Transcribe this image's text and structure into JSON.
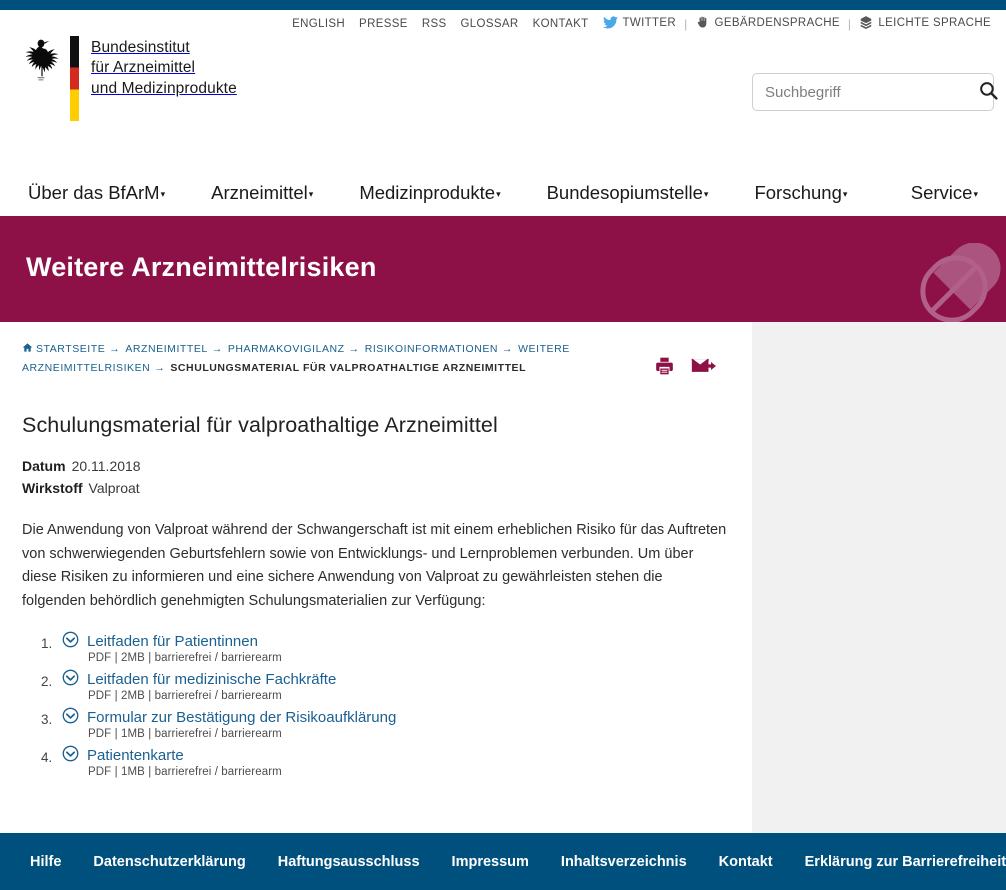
{
  "meta_nav": {
    "items": [
      {
        "label": "ENGLISH",
        "icon": null
      },
      {
        "label": "PRESSE",
        "icon": null
      },
      {
        "label": "RSS",
        "icon": null
      },
      {
        "label": "GLOSSAR",
        "icon": null
      },
      {
        "label": "KONTAKT",
        "icon": null
      },
      {
        "label": "TWITTER",
        "icon": "twitter-bird-icon"
      },
      {
        "label": "GEBÄRDENSPRACHE",
        "icon": "sign-language-hand-icon"
      },
      {
        "label": "LEICHTE SPRACHE",
        "icon": "easy-language-icon"
      }
    ],
    "separator": "|"
  },
  "logo": {
    "eagle_alt": "bundesadler-icon",
    "line1": "Bundesinstitut",
    "line2": "für Arzneimittel",
    "line3": "und Medizinprodukte"
  },
  "search": {
    "placeholder": "Suchbegriff",
    "value": "",
    "button_label": "search-icon"
  },
  "main_nav": {
    "items": [
      {
        "label": "Über das BfArM",
        "has_submenu": true
      },
      {
        "label": "Arzneimittel",
        "has_submenu": true
      },
      {
        "label": "Medizinprodukte",
        "has_submenu": true
      },
      {
        "label": "Bundesopiumstelle",
        "has_submenu": true
      },
      {
        "label": "Forschung",
        "has_submenu": true
      },
      {
        "label": "Service",
        "has_submenu": true
      }
    ],
    "caret": "▾"
  },
  "banner": {
    "title": "Weitere Arzneimittelrisiken",
    "bg_color": "#8d1146",
    "decor_icon": "pill-capsule-icon"
  },
  "breadcrumb": {
    "home_icon": "home-icon",
    "arrow": "→",
    "items": [
      {
        "label": "STARTSEITE",
        "current": false
      },
      {
        "label": "ARZNEIMITTEL",
        "current": false
      },
      {
        "label": "PHARMAKOVIGILANZ",
        "current": false
      },
      {
        "label": "RISIKOINFORMATIONEN",
        "current": false
      },
      {
        "label": "WEITERE ARZNEIMITTELRISIKEN",
        "current": false
      },
      {
        "label": "SCHULUNGSMATERIAL FÜR VALPROATHALTIGE ARZNEIMITTEL",
        "current": true
      }
    ]
  },
  "page_tools": [
    {
      "name": "print-icon",
      "title": "Drucken"
    },
    {
      "name": "email-icon",
      "title": "Empfehlen"
    }
  ],
  "article": {
    "title": "Schulungsmaterial für valproathaltige Arzneimittel",
    "meta": [
      {
        "key": "Datum",
        "value": "20.11.2018"
      },
      {
        "key": "Wirkstoff",
        "value": "Valproat"
      }
    ],
    "paragraph": "Die Anwendung von Valproat während der Schwangerschaft ist mit einem erheblichen Risiko für das Auftreten von schwerwiegenden Geburtsfehlern sowie von Entwicklungs- und Lernproblemen verbunden. Um über diese Risiken zu informieren und eine sichere Anwendung von Valproat zu gewährleisten stehen die folgenden behördlich genehmigten Schulungsmaterialien zur Verfügung:",
    "downloads": [
      {
        "number": "1.",
        "icon": "download-chevron-icon",
        "label": "Leitfaden für Patientinnen",
        "meta": "PDF | 2MB | barrierefrei / barrierearm"
      },
      {
        "number": "2.",
        "icon": "download-chevron-icon",
        "label": "Leitfaden für medizinische Fachkräfte",
        "meta": "PDF | 2MB | barrierefrei / barrierearm"
      },
      {
        "number": "3.",
        "icon": "download-chevron-icon",
        "label": "Formular zur Bestätigung der Risikoaufklärung",
        "meta": "PDF | 1MB | barrierefrei / barrierearm"
      },
      {
        "number": "4.",
        "icon": "download-chevron-icon",
        "label": "Patientenkarte",
        "meta": "PDF | 1MB | barrierefrei / barrierearm"
      }
    ]
  },
  "footer": {
    "bg_color": "#00507d",
    "items": [
      {
        "label": "Hilfe"
      },
      {
        "label": "Datenschutzerklärung"
      },
      {
        "label": "Haftungsausschluss"
      },
      {
        "label": "Impressum"
      },
      {
        "label": "Inhaltsverzeichnis"
      },
      {
        "label": "Kontakt"
      },
      {
        "label": "Erklärung zur Barrierefreiheit"
      }
    ]
  },
  "colors": {
    "brand_blue": "#00507d",
    "brand_magenta": "#8d1146",
    "link_blue": "#1c6091",
    "sidebar_gray": "#f1f1f1"
  }
}
